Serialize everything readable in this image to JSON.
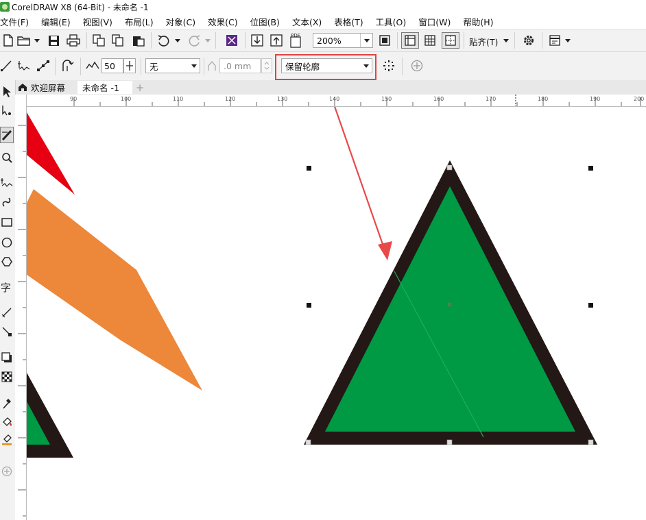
{
  "window": {
    "title": "CorelDRAW X8 (64-Bit) - 未命名 -1",
    "app_icon": "coreldraw-icon"
  },
  "menu": [
    "文件(F)",
    "编辑(E)",
    "视图(V)",
    "布局(L)",
    "对象(C)",
    "效果(C)",
    "位图(B)",
    "文本(X)",
    "表格(T)",
    "工具(O)",
    "窗口(W)",
    "帮助(H)"
  ],
  "toolbar": {
    "zoom_value": "200%",
    "snap_label": "贴齐(T)",
    "pdf_label": "PDF",
    "icons": [
      "new-icon",
      "open-icon",
      "save-icon",
      "print-icon",
      "import-icon",
      "copy-icon",
      "paste-icon",
      "undo-icon",
      "redo-icon",
      "launch-icon",
      "import-arrow-icon",
      "export-arrow-icon",
      "pdf-icon",
      "full-screen-icon",
      "rulers-icon",
      "grid-icon",
      "guidelines-icon",
      "options-gear-icon",
      "app-launcher-icon"
    ]
  },
  "property_bar": {
    "smoothing_value": "50",
    "line_style_value": "无",
    "width_value": ".0 mm",
    "outline_mode_value": "保留轮廓",
    "icons": [
      "freehand-icon",
      "polyline-icon",
      "bezier-icon",
      "closed-curve-icon",
      "smoothing-icon",
      "stepper-icon",
      "outline-width-icon",
      "auto-close-icon",
      "add-icon"
    ]
  },
  "tabs": {
    "welcome": "欢迎屏幕",
    "document": "未命名 -1",
    "add": "+"
  },
  "ruler": {
    "h_labels": [
      "90",
      "100",
      "110",
      "120",
      "130",
      "140",
      "150",
      "160",
      "170",
      "180",
      "190",
      "200"
    ],
    "v_labels": [
      "8",
      "20",
      "60",
      "40",
      "20",
      "0",
      "20",
      "40",
      "60",
      "80",
      "10"
    ]
  },
  "canvas": {
    "fill_color": "#009944",
    "outline_color": "#231815",
    "red_shape": "#e60012",
    "orange_shape": "#ed8739",
    "annotation_color": "#e84a4a"
  },
  "toolbox": [
    "pick-tool-icon",
    "shape-tool-icon",
    "crop-tool-icon",
    "zoom-tool-icon",
    "freehand-tool-icon",
    "artistic-media-icon",
    "rectangle-tool-icon",
    "ellipse-tool-icon",
    "polygon-tool-icon",
    "text-tool-icon",
    "parallel-dimension-icon",
    "connector-tool-icon",
    "drop-shadow-icon",
    "transparency-icon",
    "eyedropper-icon",
    "interactive-fill-icon",
    "smart-fill-icon",
    "add-tool-icon"
  ]
}
